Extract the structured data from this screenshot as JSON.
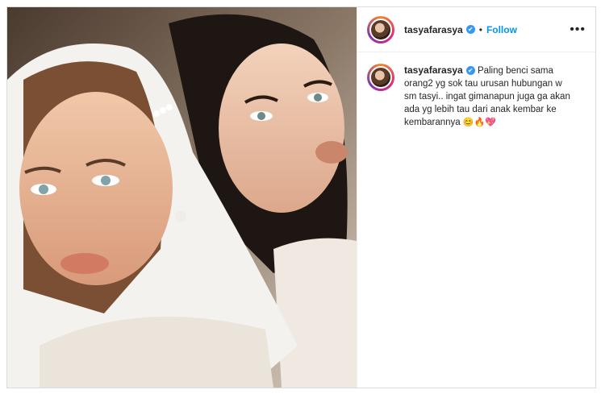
{
  "post": {
    "username": "tasyafarasya",
    "verified_icon": "✔",
    "separator": "•",
    "follow_label": "Follow",
    "more_label": "•••",
    "caption_text": "Paling benci sama orang2 yg sok tau urusan hubungan w sm tasyi.. ingat gimanapun juga ga akan ada yg lebih tau dari anak kembar ke kembarannya",
    "caption_emojis": "😊🔥💖"
  },
  "icons": {
    "verified": "verified-badge-icon",
    "more": "more-options-icon"
  },
  "colors": {
    "follow": "#0095f6",
    "verified": "#3897f0",
    "border": "#dbdbdb",
    "text": "#262626"
  }
}
